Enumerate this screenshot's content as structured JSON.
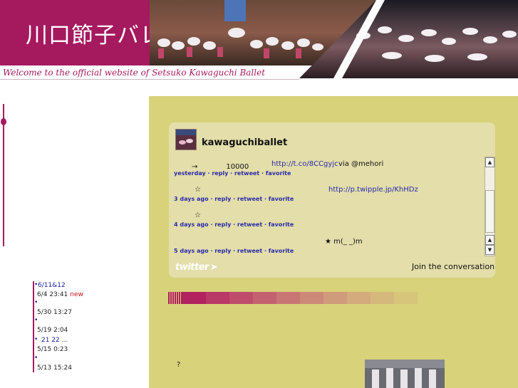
{
  "header": {
    "title": "川口節子バレエ団",
    "tagline": "Welcome to the official website of Setsuko Kawaguchi Ballet"
  },
  "colors": {
    "brand": "#a5195e",
    "panel": "#d8d27a",
    "widget": "#e3deaa",
    "link": "#2a2aa8"
  },
  "news": [
    {
      "text": "6/11&12",
      "is_link": true
    },
    {
      "text": "6/4 23:41",
      "badge": "new"
    },
    {
      "text": "5/30 13:27"
    },
    {
      "text": "5/19 2:04"
    },
    {
      "text": "21 22 ...",
      "is_link": true
    },
    {
      "text": "5/15 0:23"
    },
    {
      "text": "5/13 15:24"
    }
  ],
  "twitter": {
    "handle": "kawaguchiballet",
    "tweets": [
      {
        "text": "→　　　　10000",
        "link": "http://t.co/8CCgyjc",
        "via": "via @mehori",
        "time": "yesterday"
      },
      {
        "text": "☆",
        "link": "http://p.twipple.jp/KhHDz",
        "time": "3 days ago"
      },
      {
        "text": "☆",
        "time": "4 days ago"
      },
      {
        "text": "★ m(_ _)m",
        "time": "5 days ago"
      }
    ],
    "actions": {
      "reply": "reply",
      "retweet": "retweet",
      "favorite": "favorite"
    },
    "logo": "twitter",
    "join": "Join the conversation"
  },
  "main": {
    "question": "?"
  }
}
